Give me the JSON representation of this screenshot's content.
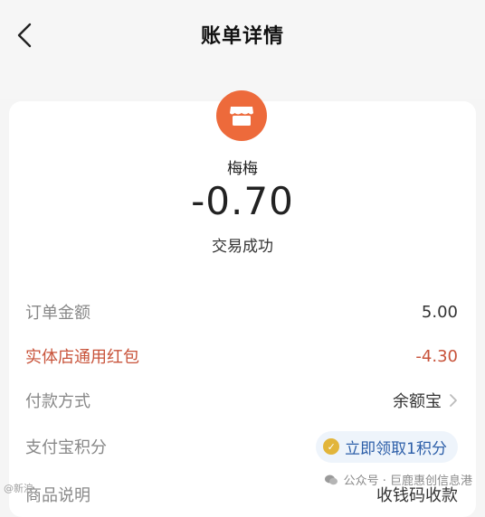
{
  "header": {
    "title": "账单详情"
  },
  "merchant": {
    "name": "梅梅",
    "icon": "store-icon"
  },
  "transaction": {
    "amount": "-0.70",
    "status": "交易成功"
  },
  "details": [
    {
      "label": "订单金额",
      "value": "5.00"
    },
    {
      "label": "实体店通用红包",
      "value": "-4.30"
    },
    {
      "label": "付款方式",
      "value": "余额宝"
    },
    {
      "label": "支付宝积分",
      "value": "立即领取1积分"
    },
    {
      "label": "商品说明",
      "value": "收钱码收款"
    }
  ],
  "watermark": {
    "right_text": "公众号 · 巨鹿惠创信息港",
    "left_text": "@新浪"
  },
  "colors": {
    "accent_orange": "#ed6a3b",
    "discount_red": "#c8533a",
    "link_blue": "#2c5ea8"
  }
}
